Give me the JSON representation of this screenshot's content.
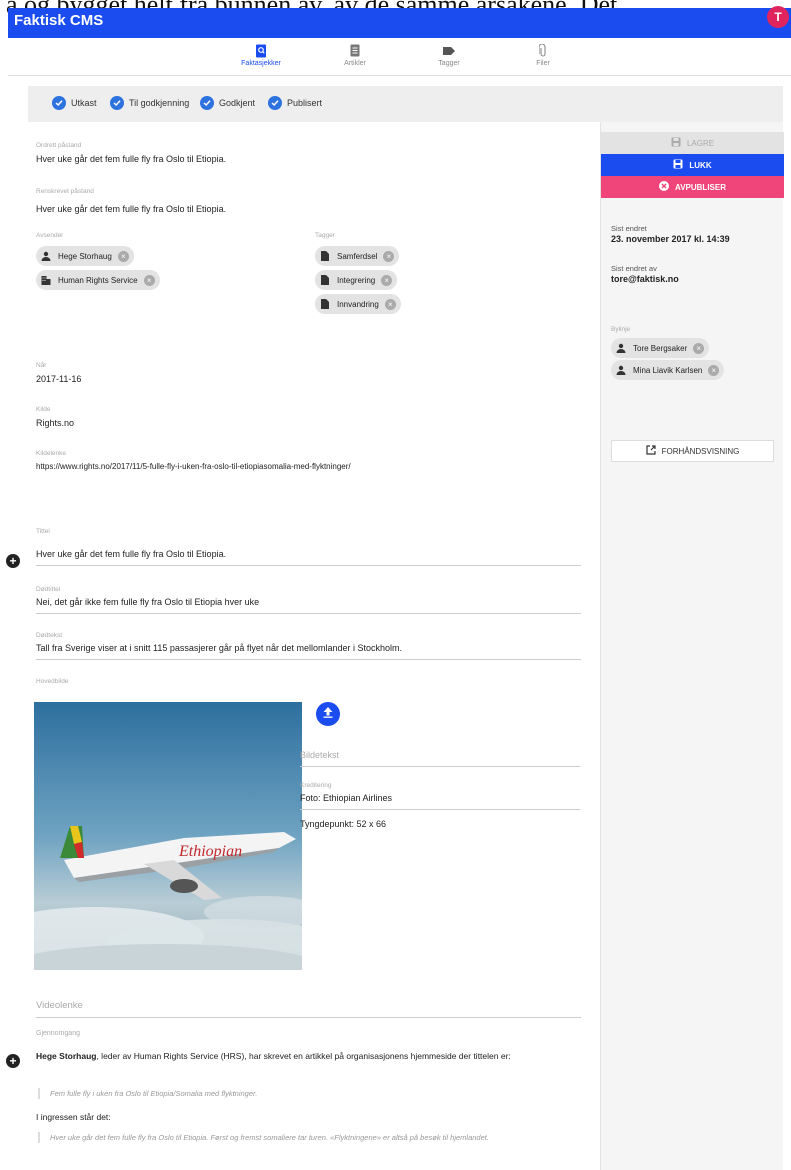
{
  "overlay_text": "a og bygget helt fra bunnen av, av de samme årsakene. Det",
  "app": {
    "title": "Faktisk CMS",
    "avatar_initial": "T"
  },
  "nav": {
    "tabs": [
      {
        "label": "Faktasjekker",
        "icon": "search-doc-icon",
        "active": true
      },
      {
        "label": "Artikler",
        "icon": "document-icon",
        "active": false
      },
      {
        "label": "Tagger",
        "icon": "tag-icon",
        "active": false
      },
      {
        "label": "Filer",
        "icon": "paperclip-icon",
        "active": false
      }
    ]
  },
  "status_steps": [
    {
      "label": "Utkast"
    },
    {
      "label": "Til godkjenning"
    },
    {
      "label": "Godkjent"
    },
    {
      "label": "Publisert"
    }
  ],
  "form": {
    "original_claim": {
      "label": "Ordrett påstand",
      "value": "Hver uke går det fem fulle fly fra Oslo til Etiopia."
    },
    "refined_claim": {
      "label": "Renskrevet påstand",
      "value": "Hver uke går det fem fulle fly fra Oslo til Etiopia."
    },
    "senders": {
      "label": "Avsender",
      "items": [
        "Hege Storhaug",
        "Human Rights Service"
      ]
    },
    "tags": {
      "label": "Tagger",
      "items": [
        "Samferdsel",
        "Integrering",
        "Innvandring"
      ]
    },
    "when": {
      "label": "Når",
      "value": "2017-11-16"
    },
    "source": {
      "label": "Kilde",
      "value": "Rights.no"
    },
    "source_link": {
      "label": "Kildelenke",
      "value": "https://www.rights.no/2017/11/5-fulle-fly-i-uken-fra-oslo-til-etiopiasomalia-med-flyktninger/"
    },
    "title": {
      "label": "Tittel",
      "value": "Hver uke går det fem fulle fly fra Oslo til Etiopia."
    },
    "subtitle": {
      "label": "Dødtittel",
      "value": "Nei, det går ikke fem fulle fly fra Oslo til Etiopia hver uke"
    },
    "detail": {
      "label": "Dødtekst",
      "value": "Tall fra Sverige viser at i snitt 115 passasjerer går på flyet når det mellomlander i Stockholm."
    },
    "main_image": {
      "label": "Hovedbilde",
      "caption_placeholder": "Bildetekst",
      "credit_label": "Kreditering",
      "credit_value": "Foto: Ethiopian Airlines",
      "focus": "Tyngdepunkt: 52 x 66",
      "plane_text": "Ethiopian"
    },
    "video_link": {
      "placeholder": "Videolenke"
    },
    "review": {
      "label": "Gjennomgang",
      "author": "Hege Storhaug",
      "intro_rest": ", leder av Human Rights Service (HRS), har skrevet en artikkel på organisasjonens hjemmeside der tittelen er:",
      "quote1": "Fem fulle fly i uken fra Oslo til Etiopia/Somalia med flyktninger.",
      "ingress_label": "I ingressen står det:",
      "quote2": "Hver uke går det fem fulle fly fra Oslo til Etiopia. Først og fremst somaliere tar turen. «Flyktningene» er altså på besøk til hjemlandet."
    }
  },
  "sidebar": {
    "save_label": "LAGRE",
    "close_label": "LUKK",
    "unpublish_label": "AVPUBLISER",
    "last_changed_label": "Sist endret",
    "last_changed_value": "23. november 2017 kl. 14:39",
    "last_changed_by_label": "Sist endret av",
    "last_changed_by_value": "tore@faktisk.no",
    "authors_label": "Bylinje",
    "authors": [
      "Tore Bergsaker",
      "Mina Liavik Karlsen"
    ],
    "preview_label": "FORHÅNDSVISNING"
  },
  "colors": {
    "primary": "#1a4cf0",
    "danger": "#f0457b",
    "check": "#2e72e0"
  }
}
